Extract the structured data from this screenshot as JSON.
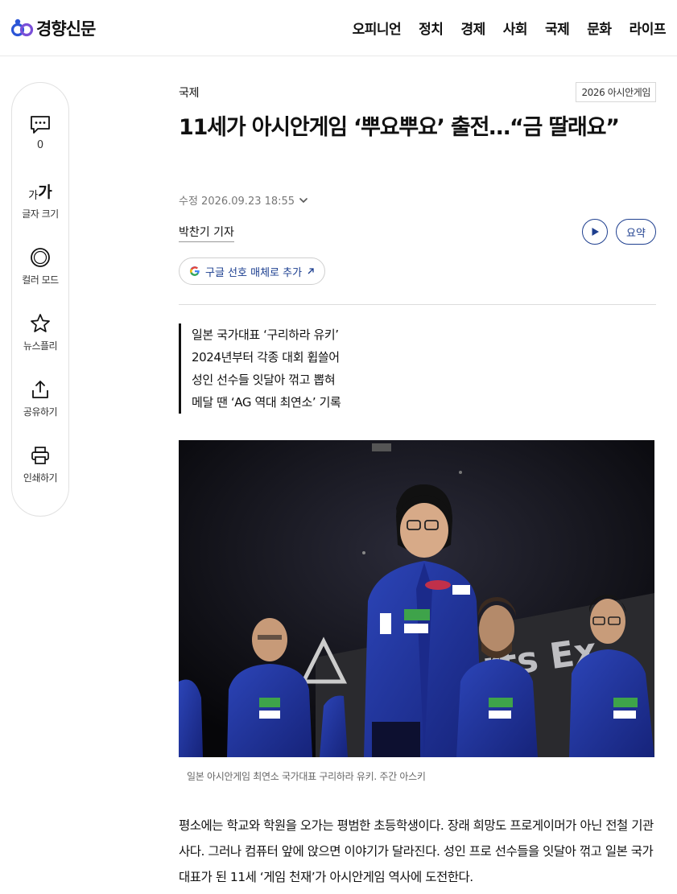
{
  "header": {
    "logo_text": "경향신문",
    "nav": [
      "오피니언",
      "정치",
      "경제",
      "사회",
      "국제",
      "문화",
      "라이프"
    ]
  },
  "sidebar": {
    "comment_count": "0",
    "font_size_small": "가",
    "font_size_big": "가",
    "font_size_label": "글자 크기",
    "color_mode_label": "컬러 모드",
    "newsplay_label": "뉴스플리",
    "share_label": "공유하기",
    "print_label": "인쇄하기"
  },
  "article": {
    "section": "국제",
    "series_badge": "2026 아시안게임",
    "headline": "11세가 아시안게임 ‘뿌요뿌요’ 출전…“금 딸래요”",
    "dateline": "수정 2026.09.23 18:55",
    "byline": "박찬기 기자",
    "summary_button": "요약",
    "google_chip": "구글 선호 매체로 추가",
    "summary": [
      "일본 국가대표 ‘구리하라 유키’",
      "2024년부터 각종 대회 휩쓸어",
      "성인 선수들 잇달아 꺾고 뽑혀",
      "메달 땐 ‘AG 역대 최연소’ 기록"
    ],
    "photo_caption": "일본 아시안게임 최연소 국가대표 구리하라 유키. 주간 아스키",
    "body": "평소에는 학교와 학원을 오가는 평범한 초등학생이다. 장래 희망도 프로게이머가 아닌 전철 기관사다. 그러나 컴퓨터 앞에 앉으면 이야기가 달라진다. 성인 프로 선수들을 잇달아 꺾고 일본 국가대표가 된 11세 ‘게임 천재’가 아시안게임 역사에 도전한다.",
    "photo_backdrop_text": "orts Ex"
  },
  "colors": {
    "accent": "#1e3f8f",
    "logo_blue": "#2b55d6",
    "logo_violet": "#7a4fd8"
  }
}
